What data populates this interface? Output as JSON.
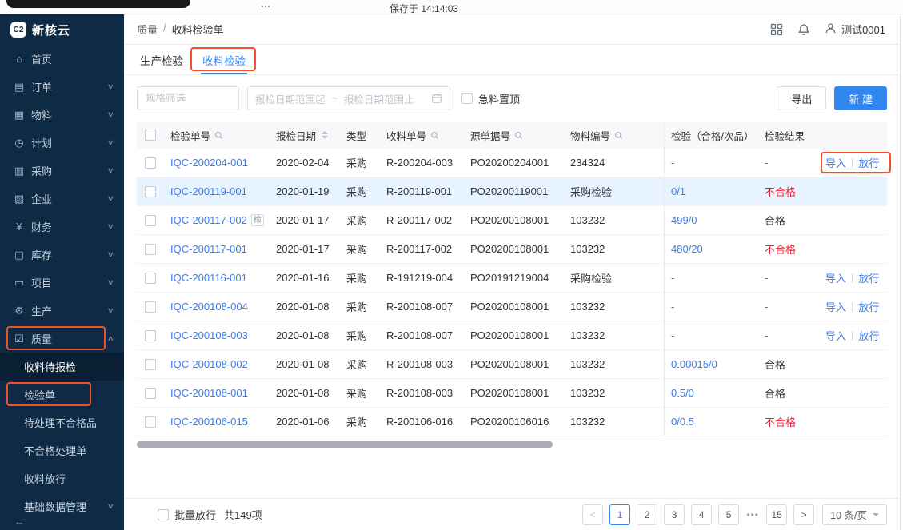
{
  "colors": {
    "accent": "#3186f0",
    "link": "#3a7cf0",
    "danger": "#f5222d",
    "annotation": "#f0512b",
    "sidebar_bg": "#0e2a45",
    "sidebar_active_bg": "#0a1f34"
  },
  "external": {
    "dots": "⋯",
    "saved": "保存于 14:14:03"
  },
  "brand": {
    "mark": "C2",
    "name": "新核云"
  },
  "header": {
    "breadcrumb": [
      "质量",
      "收料检验单"
    ],
    "separator": "/",
    "user": "测试0001"
  },
  "sidebar": {
    "items": [
      {
        "name": "home",
        "label": "首页",
        "icon": "home"
      },
      {
        "name": "orders",
        "label": "订单",
        "icon": "order",
        "chevron": "down"
      },
      {
        "name": "materials",
        "label": "物料",
        "icon": "material",
        "chevron": "down"
      },
      {
        "name": "plans",
        "label": "计划",
        "icon": "plan",
        "chevron": "down"
      },
      {
        "name": "purchasing",
        "label": "采购",
        "icon": "purchase",
        "chevron": "down"
      },
      {
        "name": "enterprise",
        "label": "企业",
        "icon": "enterprise",
        "chevron": "down"
      },
      {
        "name": "finance",
        "label": "财务",
        "icon": "finance",
        "chevron": "down"
      },
      {
        "name": "inventory",
        "label": "库存",
        "icon": "inventory",
        "chevron": "down"
      },
      {
        "name": "projects",
        "label": "项目",
        "icon": "project",
        "chevron": "down"
      },
      {
        "name": "production",
        "label": "生产",
        "icon": "production",
        "chevron": "down"
      },
      {
        "name": "quality",
        "label": "质量",
        "icon": "quality",
        "chevron": "up"
      },
      {
        "name": "receiving-pending-inspection",
        "label": "收料待报检",
        "sub": true,
        "active": true
      },
      {
        "name": "inspection-orders",
        "label": "检验单",
        "sub": true
      },
      {
        "name": "pending-nonconforming",
        "label": "待处理不合格品",
        "sub": true
      },
      {
        "name": "nonconforming-handling",
        "label": "不合格处理单",
        "sub": true
      },
      {
        "name": "receiving-release",
        "label": "收料放行",
        "sub": true
      },
      {
        "name": "base-data",
        "label": "基础数据管理",
        "sub": true,
        "chevron": "down"
      }
    ],
    "collapse_icon": "←"
  },
  "tabs": [
    {
      "name": "production-inspection",
      "label": "生产检验",
      "active": false
    },
    {
      "name": "receiving-inspection",
      "label": "收料检验",
      "active": true
    }
  ],
  "filters": {
    "spec_placeholder": "规格筛选",
    "date_start_placeholder": "报检日期范围起",
    "date_tilde": "~",
    "date_end_placeholder": "报检日期范围止",
    "urgent_label": "急料置顶",
    "export_label": "导出",
    "create_label": "新 建"
  },
  "table": {
    "columns": [
      {
        "label": "检验单号",
        "icon": "search"
      },
      {
        "label": "报检日期",
        "icon": "sort"
      },
      {
        "label": "类型"
      },
      {
        "label": "收料单号",
        "icon": "search"
      },
      {
        "label": "源单据号",
        "icon": "search"
      },
      {
        "label": "物料编号",
        "icon": "search"
      },
      {
        "label": "检验（合格/次品）"
      },
      {
        "label": "检验结果"
      },
      {
        "label": ""
      }
    ],
    "rows": [
      {
        "id": "IQC-200204-001",
        "date": "2020-02-04",
        "type": "采购",
        "receipt": "R-200204-003",
        "source": "PO20200204001",
        "material": "234324",
        "inspection": "-",
        "result": "-",
        "result_state": "none",
        "actions": [
          "导入",
          "放行"
        ],
        "selected": false
      },
      {
        "id": "IQC-200119-001",
        "date": "2020-01-19",
        "type": "采购",
        "receipt": "R-200119-001",
        "source": "PO20200119001",
        "material": "采购检验",
        "inspection": "0/1",
        "result": "不合格",
        "result_state": "fail",
        "actions": null,
        "selected": true
      },
      {
        "id": "IQC-200117-002",
        "tag": "检",
        "date": "2020-01-17",
        "type": "采购",
        "receipt": "R-200117-002",
        "source": "PO20200108001",
        "material": "103232",
        "inspection": "499/0",
        "result": "合格",
        "result_state": "pass",
        "actions": null,
        "selected": false
      },
      {
        "id": "IQC-200117-001",
        "date": "2020-01-17",
        "type": "采购",
        "receipt": "R-200117-002",
        "source": "PO20200108001",
        "material": "103232",
        "inspection": "480/20",
        "result": "不合格",
        "result_state": "fail",
        "actions": null,
        "selected": false
      },
      {
        "id": "IQC-200116-001",
        "date": "2020-01-16",
        "type": "采购",
        "receipt": "R-191219-004",
        "source": "PO20191219004",
        "material": "采购检验",
        "inspection": "-",
        "result": "-",
        "result_state": "none",
        "actions": [
          "导入",
          "放行"
        ],
        "selected": false
      },
      {
        "id": "IQC-200108-004",
        "date": "2020-01-08",
        "type": "采购",
        "receipt": "R-200108-007",
        "source": "PO20200108001",
        "material": "103232",
        "inspection": "-",
        "result": "-",
        "result_state": "none",
        "actions": [
          "导入",
          "放行"
        ],
        "selected": false
      },
      {
        "id": "IQC-200108-003",
        "date": "2020-01-08",
        "type": "采购",
        "receipt": "R-200108-007",
        "source": "PO20200108001",
        "material": "103232",
        "inspection": "-",
        "result": "-",
        "result_state": "none",
        "actions": [
          "导入",
          "放行"
        ],
        "selected": false
      },
      {
        "id": "IQC-200108-002",
        "date": "2020-01-08",
        "type": "采购",
        "receipt": "R-200108-003",
        "source": "PO20200108001",
        "material": "103232",
        "inspection": "0.00015/0",
        "result": "合格",
        "result_state": "pass",
        "actions": null,
        "selected": false
      },
      {
        "id": "IQC-200108-001",
        "date": "2020-01-08",
        "type": "采购",
        "receipt": "R-200108-003",
        "source": "PO20200108001",
        "material": "103232",
        "inspection": "0.5/0",
        "result": "合格",
        "result_state": "pass",
        "actions": null,
        "selected": false
      },
      {
        "id": "IQC-200106-015",
        "date": "2020-01-06",
        "type": "采购",
        "receipt": "R-200106-016",
        "source": "PO20200106016",
        "material": "103232",
        "inspection": "0/0.5",
        "result": "不合格",
        "result_state": "fail",
        "actions": null,
        "selected": false
      }
    ]
  },
  "footer": {
    "batch_label": "批量放行",
    "total": "共149项",
    "pager": {
      "prev": "<",
      "pages": [
        "1",
        "2",
        "3",
        "4",
        "5",
        "•••",
        "15"
      ],
      "active": "1",
      "next": ">",
      "size_label": "10 条/页"
    }
  }
}
